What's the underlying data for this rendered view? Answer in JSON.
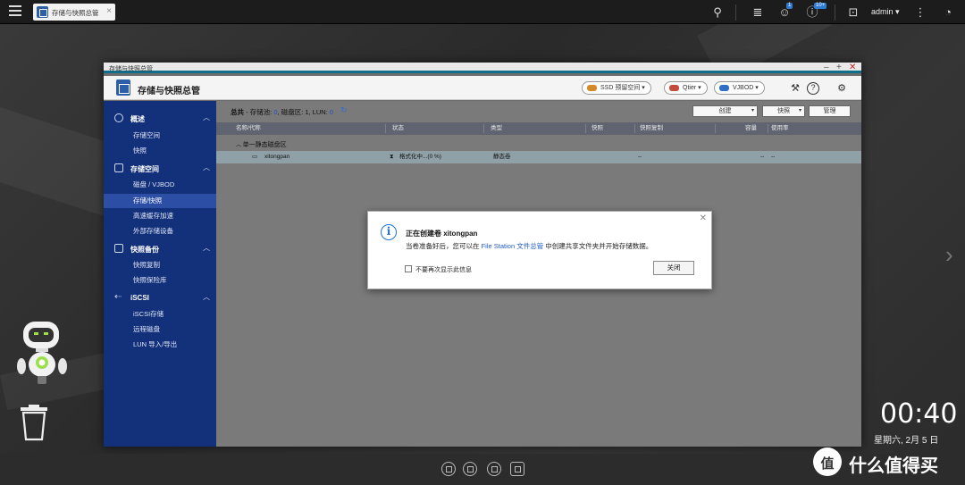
{
  "topbar": {
    "tab_label": "存储与快照总管",
    "notif_badge_1": "1",
    "notif_badge_2": "10+",
    "username": "admin ▾"
  },
  "window": {
    "title": "存储与快照总管",
    "app_title": "存储与快照总管",
    "header_buttons": {
      "ssd": "SSD 预留空间 ▾",
      "qtier": "Qtier ▾",
      "vjbod": "VJBOD ▾"
    },
    "controls": {
      "minimize": "–",
      "maximize": "+",
      "close": "✕"
    }
  },
  "sidebar": {
    "groups": [
      {
        "label": "概述",
        "items": [
          "存储空间",
          "快照"
        ]
      },
      {
        "label": "存储空间",
        "items": [
          "磁盘 / VJBOD",
          "存储/快照",
          "高速缓存加速",
          "外部存储设备"
        ]
      },
      {
        "label": "快照备份",
        "items": [
          "快照复制",
          "快照保险库"
        ]
      },
      {
        "label": "iSCSI",
        "items": [
          "iSCSI存储",
          "远程磁盘",
          "LUN 导入/导出"
        ]
      }
    ],
    "active_item": "存储/快照"
  },
  "content": {
    "summary": {
      "prefix": "总共",
      "pools_label": "- 存储池:",
      "pools": "0",
      "disks_label": ", 磁盘区: 1, LUN:",
      "luns": "0"
    },
    "actions": {
      "create": "创建",
      "snapshot": "快照",
      "manage": "管理"
    },
    "columns": [
      "名称/代称",
      "状态",
      "类型",
      "快照",
      "快照复制",
      "容量",
      "使用率"
    ],
    "group_row": "单一静态磁盘区",
    "volume_row": {
      "name": "xitongpan",
      "status": "格式化中...(0 %)",
      "type": "静态卷",
      "snapshot_replica": "--",
      "capacity": "--",
      "usage": "--"
    }
  },
  "dialog": {
    "title": "正在创建卷 xitongpan",
    "message_before": "当卷准备好后，您可以在 ",
    "message_link": "File Station 文件总管",
    "message_after": " 中创建共享文件夹并开始存储数据。",
    "checkbox_label": "不要再次显示此信息",
    "close_button": "关闭"
  },
  "desktop": {
    "time": "00:40",
    "date": "星期六, 2月 5 日",
    "watermark": "什么值得买"
  }
}
